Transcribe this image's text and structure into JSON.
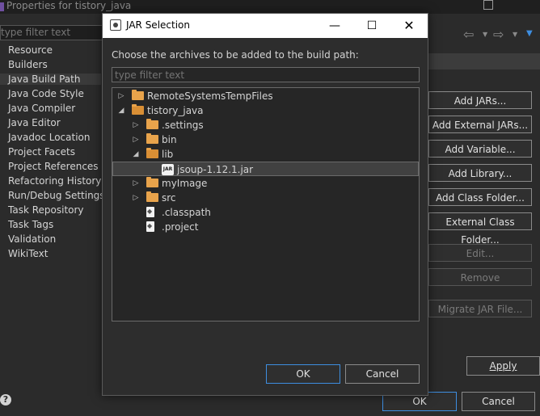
{
  "background_window": {
    "title": "Properties for tistory_java",
    "filter_placeholder": "type filter text",
    "nav_items": [
      "Resource",
      "Builders",
      "Java Build Path",
      "Java Code Style",
      "Java Compiler",
      "Java Editor",
      "Javadoc Location",
      "Project Facets",
      "Project References",
      "Refactoring History",
      "Run/Debug Settings",
      "Task Repository",
      "Task Tags",
      "Validation",
      "WikiText"
    ],
    "selected_nav": "Java Build Path",
    "side_buttons": [
      {
        "label": "Add JARs...",
        "enabled": true
      },
      {
        "label": "Add External JARs...",
        "enabled": true
      },
      {
        "label": "Add Variable...",
        "enabled": true
      },
      {
        "label": "Add Library...",
        "enabled": true
      },
      {
        "label": "Add Class Folder...",
        "enabled": true
      },
      {
        "label": "External Class Folder...",
        "enabled": true
      },
      {
        "label": "Edit...",
        "enabled": false
      },
      {
        "label": "Remove",
        "enabled": false
      },
      {
        "label": "Migrate JAR File...",
        "enabled": false
      }
    ],
    "apply_label": "Apply",
    "ok_label": "OK",
    "cancel_label": "Cancel"
  },
  "dialog": {
    "title": "JAR Selection",
    "instruction": "Choose the archives to be added to the build path:",
    "filter_placeholder": "type filter text",
    "tree": [
      {
        "label": "RemoteSystemsTempFiles",
        "depth": 0,
        "type": "folder",
        "expanded": false,
        "has_children": true
      },
      {
        "label": "tistory_java",
        "depth": 0,
        "type": "project",
        "expanded": true,
        "has_children": true
      },
      {
        "label": ".settings",
        "depth": 1,
        "type": "folder",
        "expanded": false,
        "has_children": true
      },
      {
        "label": "bin",
        "depth": 1,
        "type": "folder",
        "expanded": false,
        "has_children": true
      },
      {
        "label": "lib",
        "depth": 1,
        "type": "folder",
        "expanded": true,
        "has_children": true
      },
      {
        "label": "jsoup-1.12.1.jar",
        "depth": 2,
        "type": "jar",
        "expanded": false,
        "has_children": false,
        "selected": true
      },
      {
        "label": "myImage",
        "depth": 1,
        "type": "folder",
        "expanded": false,
        "has_children": true
      },
      {
        "label": "src",
        "depth": 1,
        "type": "folder",
        "expanded": false,
        "has_children": true
      },
      {
        "label": ".classpath",
        "depth": 1,
        "type": "file",
        "expanded": false,
        "has_children": false
      },
      {
        "label": ".project",
        "depth": 1,
        "type": "file",
        "expanded": false,
        "has_children": false
      }
    ],
    "ok_label": "OK",
    "cancel_label": "Cancel",
    "icons": {
      "minimize": "minimize-icon",
      "maximize": "maximize-icon",
      "close": "close-icon",
      "jar_icon_text": "JAR"
    }
  }
}
